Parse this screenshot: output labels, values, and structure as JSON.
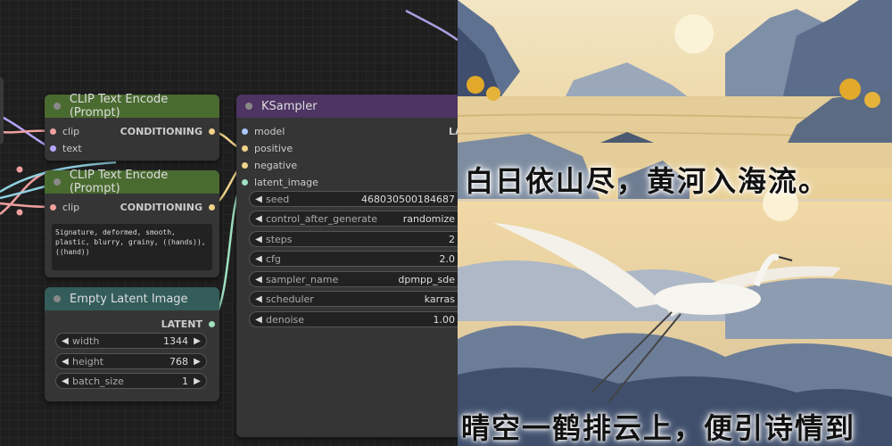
{
  "clip_text_encode_1": {
    "title": "CLIP Text Encode (Prompt)",
    "input_clip": "clip",
    "input_text": "text",
    "output": "CONDITIONING"
  },
  "clip_text_encode_2": {
    "title": "CLIP Text Encode (Prompt)",
    "input_clip": "clip",
    "output": "CONDITIONING",
    "prompt_text": "Signature, deformed, smooth, plastic, blurry, grainy, ((hands)), ((hand))"
  },
  "empty_latent": {
    "title": "Empty Latent Image",
    "output": "LATENT",
    "widgets": [
      {
        "name": "width",
        "value": "1344"
      },
      {
        "name": "height",
        "value": "768"
      },
      {
        "name": "batch_size",
        "value": "1"
      }
    ]
  },
  "ksampler": {
    "title": "KSampler",
    "inputs": [
      "model",
      "positive",
      "negative",
      "latent_image"
    ],
    "output_partial": "LA",
    "widgets": [
      {
        "name": "seed",
        "value": "468030500184687"
      },
      {
        "name": "control_after_generate",
        "value": "randomize"
      },
      {
        "name": "steps",
        "value": "2"
      },
      {
        "name": "cfg",
        "value": "2.0"
      },
      {
        "name": "sampler_name",
        "value": "dpmpp_sde"
      },
      {
        "name": "scheduler",
        "value": "karras"
      },
      {
        "name": "denoise",
        "value": "1.00"
      }
    ]
  },
  "image": {
    "poem_top": "白日依山尽，黄河入海流。",
    "poem_bottom": "晴空一鹤排云上，便引诗情到"
  },
  "colors": {
    "clip_slot": "#f0a0a0",
    "text_slot": "#b6a6ff",
    "conditioning_slot": "#f0d28a",
    "latent_slot": "#ff9cf9",
    "model_slot": "#a8c8ff"
  }
}
